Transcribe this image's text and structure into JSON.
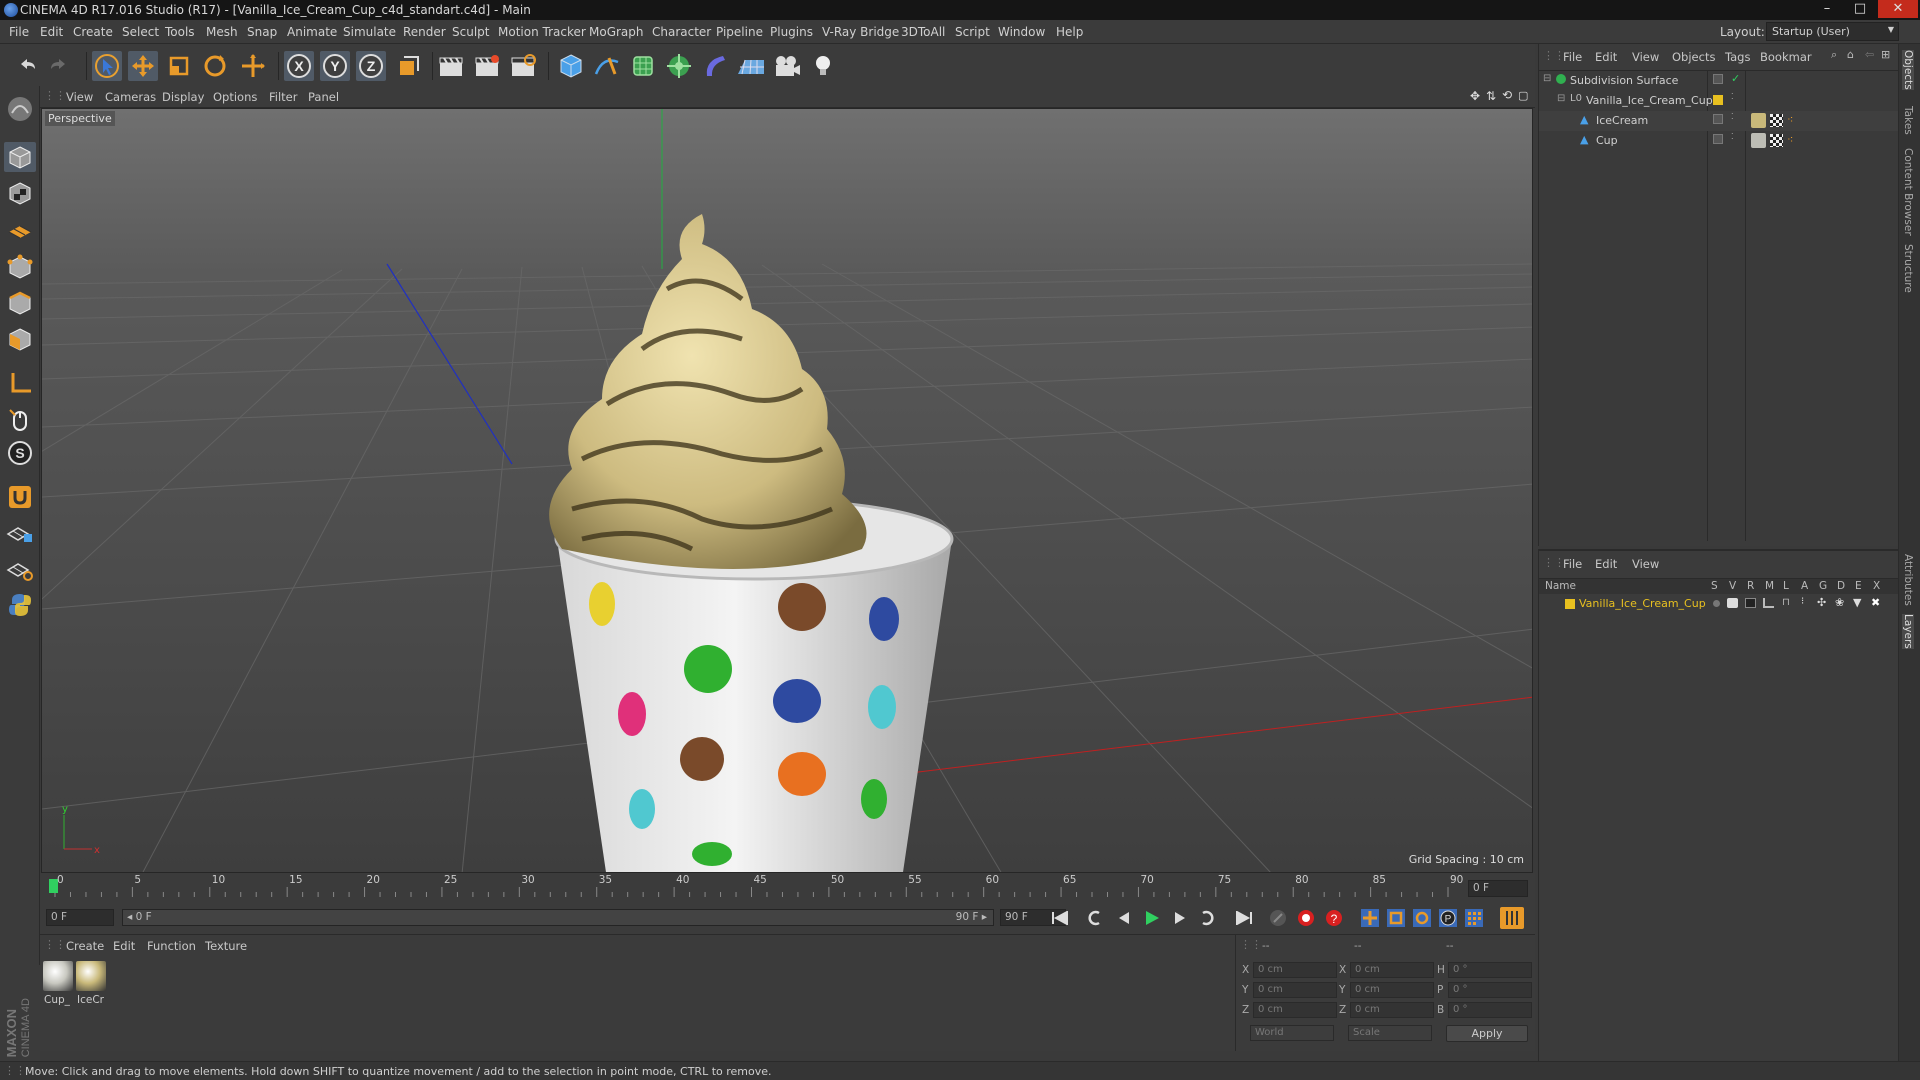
{
  "window": {
    "title": "CINEMA 4D R17.016 Studio (R17) - [Vanilla_Ice_Cream_Cup_c4d_standart.c4d] - Main",
    "minimize": "–",
    "maximize": "□",
    "close": "✕"
  },
  "menu": [
    "File",
    "Edit",
    "Create",
    "Select",
    "Tools",
    "Mesh",
    "Snap",
    "Animate",
    "Simulate",
    "Render",
    "Sculpt",
    "Motion Tracker",
    "MoGraph",
    "Character",
    "Pipeline",
    "Plugins",
    "V-Ray Bridge",
    "3DToAll",
    "Script",
    "Window",
    "Help"
  ],
  "layout": {
    "label": "Layout:",
    "value": "Startup (User)"
  },
  "viewport_menu": [
    "View",
    "Cameras",
    "Display",
    "Options",
    "Filter",
    "Panel"
  ],
  "viewport": {
    "label": "Perspective",
    "grid_spacing": "Grid Spacing : 10 cm",
    "axis_x": "x",
    "axis_y": "y"
  },
  "timeline": {
    "ticks": [
      "0",
      "5",
      "10",
      "15",
      "20",
      "25",
      "30",
      "35",
      "40",
      "45",
      "50",
      "55",
      "60",
      "65",
      "70",
      "75",
      "80",
      "85",
      "90"
    ],
    "current_frame_field": "0 F",
    "start_field": "0 F",
    "range_start": "◂ 0 F",
    "range_end": "90 F ▸",
    "end_field": "90 F",
    "end_field_2": "90 F"
  },
  "material_menu": [
    "Create",
    "Edit",
    "Function",
    "Texture"
  ],
  "materials": [
    {
      "label": "Cup_",
      "color": "#c8c8c0"
    },
    {
      "label": "IceCr",
      "color": "#c9b97a"
    }
  ],
  "coords": {
    "header": [
      "--",
      "--",
      "--"
    ],
    "rows": [
      {
        "a": "X",
        "av": "0 cm",
        "b": "X",
        "bv": "0 cm",
        "c": "H",
        "cv": "0 °"
      },
      {
        "a": "Y",
        "av": "0 cm",
        "b": "Y",
        "bv": "0 cm",
        "c": "P",
        "cv": "0 °"
      },
      {
        "a": "Z",
        "av": "0 cm",
        "b": "Z",
        "bv": "0 cm",
        "c": "B",
        "cv": "0 °"
      }
    ],
    "mode1": "World",
    "mode2": "Scale",
    "apply": "Apply"
  },
  "status": "Move: Click and drag to move elements. Hold down SHIFT to quantize movement / add to the selection in point mode, CTRL to remove.",
  "objects_menu": [
    "File",
    "Edit",
    "View",
    "Objects",
    "Tags",
    "Bookmar"
  ],
  "objects": [
    {
      "name": "Subdivision Surface",
      "indent": 0
    },
    {
      "name": "Vanilla_Ice_Cream_Cup",
      "indent": 1
    },
    {
      "name": "IceCream",
      "indent": 2
    },
    {
      "name": "Cup",
      "indent": 2
    }
  ],
  "layers_menu": [
    "File",
    "Edit",
    "View"
  ],
  "layer_columns": [
    "Name",
    "S",
    "V",
    "R",
    "M",
    "L",
    "A",
    "G",
    "D",
    "E",
    "X"
  ],
  "layers": [
    {
      "name": "Vanilla_Ice_Cream_Cup",
      "color": "#e8c020"
    }
  ],
  "right_tabs": [
    "Objects",
    "Takes",
    "Content Browser",
    "Structure",
    "Attributes",
    "Layers"
  ],
  "brand": {
    "maxon": "MAXON",
    "c4d": "CINEMA 4D"
  }
}
